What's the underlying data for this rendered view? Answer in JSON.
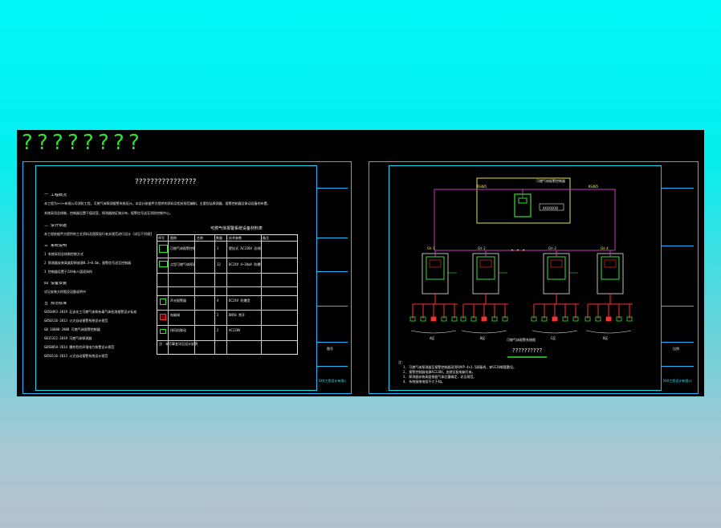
{
  "colors": {
    "background_top": "#00f7f7",
    "background_bottom": "#b3c1cf",
    "canvas": "#000000",
    "frame": "#1fb9ff",
    "symbol": "#36e036",
    "bus": "#c03cc0",
    "alarm": "#ff3030"
  },
  "header_glyphs": [
    "?",
    "?",
    "?",
    "?",
    "?",
    "?",
    "?",
    "?"
  ],
  "left_sheet": {
    "title": "????????????????",
    "sections": [
      {
        "label": "一 工程概况",
        "lines": [
          "本工程为××××有限公司消防工程，可燃气体探测报警系统设计。本设计依据甲方提供的资料及相关规范编制，主要包括探测器、报警控制器及联动设备的布置。",
          "系统采用总线制，控制器设置于值班室，探测器按区域分布，报警信号送至消防控制中心。"
        ]
      },
      {
        "label": "二 设计依据",
        "lines": [
          "本工程依据甲方提供的工艺资料及国家现行有关规范进行设计（详见下列规范）。"
        ]
      },
      {
        "label": "三 系统说明",
        "lines": [
          "1 系统采用总线制控制方式",
          "2 探测器安装高度距释放源0.3~0.6m，报警信号送至控制器",
          "3 控制器设置于24h有人值班场所"
        ]
      },
      {
        "label": "四 设备安装",
        "lines": [
          "详见安装大样图及设备说明书"
        ]
      },
      {
        "label": "五 规范标准",
        "lines": [
          "GB50493-2019 石油化工可燃气体和有毒气体检测报警设计标准",
          "GB50116-2013 火灾自动报警系统设计规范",
          "GB 16808-2008 可燃气体报警控制器",
          "GB15322-2019 可燃气体探测器",
          "GB50058-2014 爆炸危险环境电力装置设计规范",
          "GB50116-2013 火灾自动报警系统设计规范"
        ]
      }
    ],
    "table": {
      "title": "可燃气体报警系统设备材料表",
      "headers": [
        "序号",
        "图例",
        "名称",
        "数量",
        "技术参数",
        "备注"
      ],
      "rows": [
        {
          "no": "1",
          "name": "可燃气体报警控制器",
          "qty": "1",
          "spec": "壁挂式 AC220V 总线制"
        },
        {
          "no": "2",
          "name": "点型可燃气体探测器",
          "qty": "12",
          "spec": "DC24V 4~20mA 防爆型"
        },
        {
          "no": "3",
          "name": "声光报警器",
          "qty": "4",
          "spec": "DC24V 防爆型"
        },
        {
          "no": "4",
          "name": "电磁阀",
          "qty": "2",
          "spec": "DN50 常开"
        },
        {
          "no": "5",
          "name": "排风机联动",
          "qty": "2",
          "spec": "AC220V"
        }
      ],
      "note_label": "注：未尽事宜详见设计说明"
    }
  },
  "right_sheet": {
    "top_box_label": "可燃气体报警控制器",
    "top_box_tag": "XXXXXXXX",
    "bus_left": "RS485",
    "bus_right": "RS485",
    "dots": "• • •",
    "controllers": [
      {
        "label": "A区",
        "tag": "CH-1"
      },
      {
        "label": "B区",
        "tag": "CH-2"
      },
      {
        "label": "C区",
        "tag": "CH-3"
      },
      {
        "label": "D区",
        "tag": "CH-4"
      }
    ],
    "diagram_title": "??????????",
    "diagram_subtitle": "可燃气体报警系统图",
    "notes_label": "注：",
    "notes": [
      "1. 可燃气体探测器至报警控制器采用RVVP-4×1.5屏蔽线，穿SC20钢管敷设。",
      "2. 报警控制器电源AC220V，由就近配电箱引来。",
      "3. 探测器安装高度根据气体比重确定，详见规范。",
      "4. 系统接地电阻不大于4Ω。"
    ]
  },
  "title_block": {
    "company": "XXX工程设计有限公司",
    "drawing_no": "图号",
    "scale": "比例"
  }
}
